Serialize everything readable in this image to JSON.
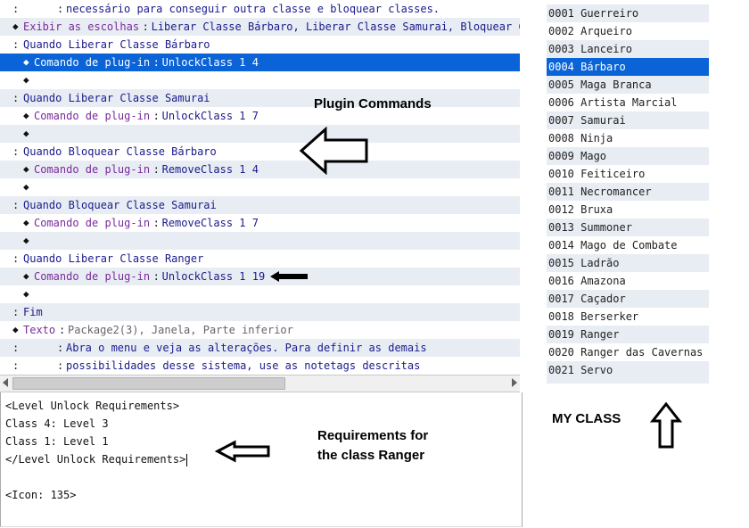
{
  "event_list": {
    "rows": [
      {
        "prefix": ":",
        "label": "",
        "sep": ":",
        "content": "necessário para conseguir outra classe e bloquear classes.",
        "label_color": "navy"
      },
      {
        "prefix": "◆",
        "label": "Exibir as escolhas",
        "sep": ":",
        "content": "Liberar Classe Bárbaro, Liberar Classe Samurai, Bloquear Cla",
        "label_color": "purple"
      },
      {
        "prefix": ":",
        "label": "Quando Liberar Classe Bárbaro",
        "sep": "",
        "content": "",
        "label_color": "navy"
      },
      {
        "prefix": "◆",
        "label": "Comando de plug-in",
        "sep": ":",
        "content": "UnlockClass 1 4",
        "label_color": "purple"
      },
      {
        "prefix": "◆",
        "label": "",
        "sep": "",
        "content": "",
        "label_color": "navy"
      },
      {
        "prefix": ":",
        "label": "Quando Liberar Classe Samurai",
        "sep": "",
        "content": "",
        "label_color": "navy"
      },
      {
        "prefix": "◆",
        "label": "Comando de plug-in",
        "sep": ":",
        "content": "UnlockClass 1 7",
        "label_color": "purple"
      },
      {
        "prefix": "◆",
        "label": "",
        "sep": "",
        "content": "",
        "label_color": "navy"
      },
      {
        "prefix": ":",
        "label": "Quando Bloquear Classe Bárbaro",
        "sep": "",
        "content": "",
        "label_color": "navy"
      },
      {
        "prefix": "◆",
        "label": "Comando de plug-in",
        "sep": ":",
        "content": "RemoveClass 1 4",
        "label_color": "purple"
      },
      {
        "prefix": "◆",
        "label": "",
        "sep": "",
        "content": "",
        "label_color": "navy"
      },
      {
        "prefix": ":",
        "label": "Quando Bloquear Classe Samurai",
        "sep": "",
        "content": "",
        "label_color": "navy"
      },
      {
        "prefix": "◆",
        "label": "Comando de plug-in",
        "sep": ":",
        "content": "RemoveClass 1 7",
        "label_color": "purple"
      },
      {
        "prefix": "◆",
        "label": "",
        "sep": "",
        "content": "",
        "label_color": "navy"
      },
      {
        "prefix": ":",
        "label": "Quando Liberar Classe Ranger",
        "sep": "",
        "content": "",
        "label_color": "navy"
      },
      {
        "prefix": "◆",
        "label": "Comando de plug-in",
        "sep": ":",
        "content": "UnlockClass 1 19",
        "label_color": "purple"
      },
      {
        "prefix": "◆",
        "label": "",
        "sep": "",
        "content": "",
        "label_color": "navy"
      },
      {
        "prefix": ":",
        "label": "Fim",
        "sep": "",
        "content": "",
        "label_color": "navy"
      },
      {
        "prefix": "◆",
        "label": "Texto",
        "sep": ":",
        "content": "Package2(3), Janela, Parte inferior",
        "label_color": "purple"
      },
      {
        "prefix": ":",
        "label": "",
        "sep": ":",
        "content": "Abra o menu e veja as alterações. Para definir as demais",
        "label_color": "navy"
      },
      {
        "prefix": ":",
        "label": "",
        "sep": ":",
        "content": "possibilidades desse sistema, use as notetags descritas",
        "label_color": "navy"
      }
    ],
    "selected_index": 3
  },
  "note": {
    "lines": [
      "<Level Unlock Requirements>",
      "Class 4: Level 3",
      "Class 1: Level 1",
      "</Level Unlock Requirements>",
      "",
      "<Icon: 135>"
    ]
  },
  "class_list": {
    "items": [
      "0001 Guerreiro",
      "0002 Arqueiro",
      "0003 Lanceiro",
      "0004 Bárbaro",
      "0005 Maga Branca",
      "0006 Artista Marcial",
      "0007 Samurai",
      "0008 Ninja",
      "0009 Mago",
      "0010 Feiticeiro",
      "0011 Necromancer",
      "0012 Bruxa",
      "0013 Summoner",
      "0014 Mago de Combate",
      "0015 Ladrão",
      "0016 Amazona",
      "0017 Caçador",
      "0018 Berserker",
      "0019 Ranger",
      "0020 Ranger das Cavernas",
      "0021 Servo"
    ],
    "selected_index": 3
  },
  "annotations": {
    "plugin_commands": "Plugin Commands",
    "requirements_line1": "Requirements for",
    "requirements_line2": "the class Ranger",
    "my_class": "MY CLASS"
  },
  "colors": {
    "selection": "#0a64d8",
    "alt_row": "#e8edf3",
    "label_navy": "#1a1a8c",
    "label_purple": "#7a2a9c"
  }
}
